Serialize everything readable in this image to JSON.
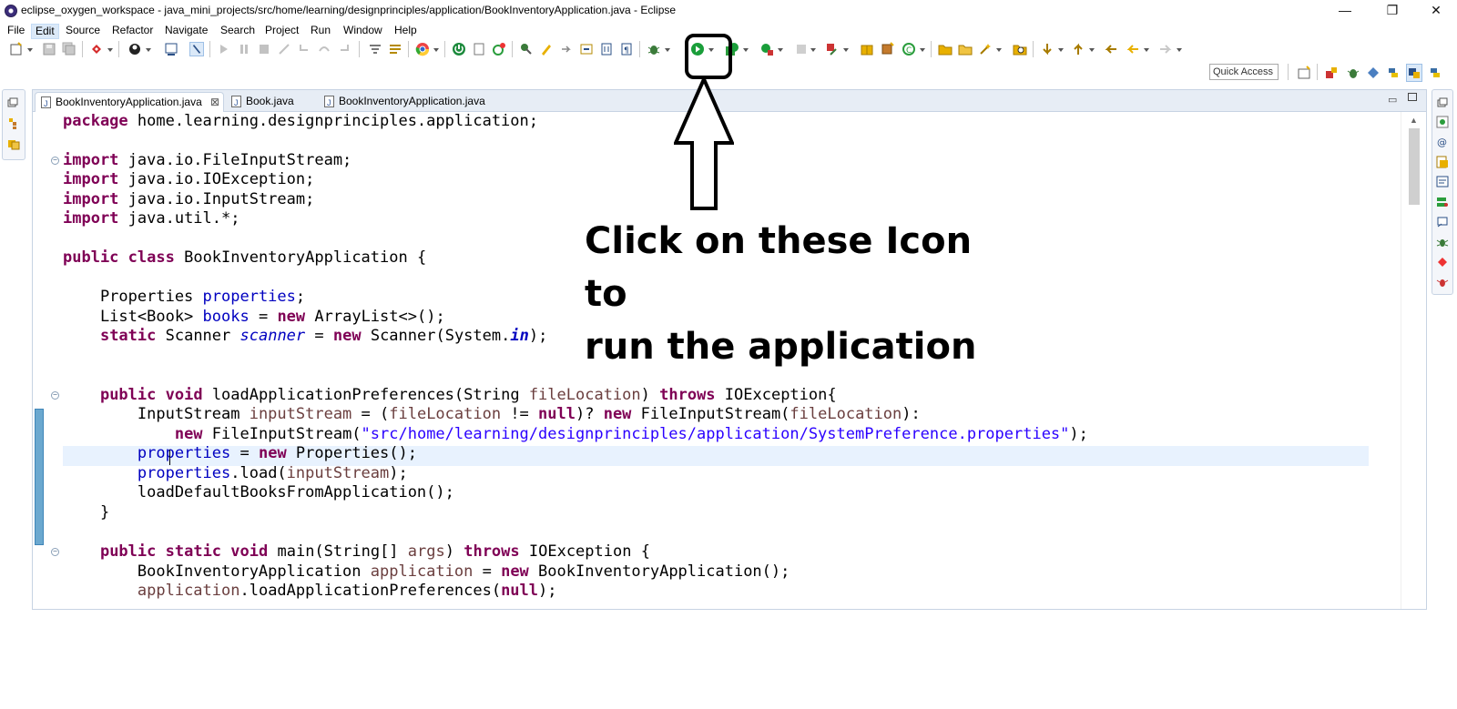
{
  "window": {
    "title": "eclipse_oxygen_workspace - java_mini_projects/src/home/learning/designprinciples/application/BookInventoryApplication.java - Eclipse",
    "minimize": "—",
    "restore": "❐",
    "close": "✕"
  },
  "menu": {
    "items": [
      "File",
      "Edit",
      "Source",
      "Refactor",
      "Navigate",
      "Search",
      "Project",
      "Run",
      "Window",
      "Help"
    ],
    "active_index": 1
  },
  "toolbar": {
    "quick_access": "Quick Access",
    "run_icon_color": "#1a9e3a",
    "debug_icon_color": "#3b7b3a"
  },
  "editor": {
    "tabs": [
      "BookInventoryApplication.java",
      "Book.java",
      "BookInventoryApplication.java"
    ],
    "active_tab": 0,
    "tab_close": "⊠",
    "code": {
      "l1": {
        "kw1": "package",
        "rest": " home.learning.designprinciples.application;"
      },
      "l3": {
        "kw": "import",
        "rest": " java.io.FileInputStream;"
      },
      "l4": {
        "kw": "import",
        "rest": " java.io.IOException;"
      },
      "l5": {
        "kw": "import",
        "rest": " java.io.InputStream;"
      },
      "l6": {
        "kw": "import",
        "rest": " java.util.*;"
      },
      "l8": {
        "kw1": "public",
        "kw2": "class",
        "rest": " BookInventoryApplication {"
      },
      "l10": {
        "type": "    Properties ",
        "field": "properties",
        "end": ";"
      },
      "l11": {
        "type": "    List<Book> ",
        "field": "books",
        "mid": " = ",
        "kw": "new",
        "end": " ArrayList<>();"
      },
      "l12": {
        "kw1": "static",
        "type": " Scanner ",
        "field": "scanner",
        "mid": " = ",
        "kw2": "new",
        "call": " Scanner(System.",
        "sfield": "in",
        "end": ");"
      },
      "l15": {
        "kw1": "public",
        "kw2": "void",
        "name": " loadApplicationPreferences(String ",
        "param": "fileLocation",
        "mid": ") ",
        "kw3": "throws",
        "end": " IOException{"
      },
      "l16": {
        "type": "        InputStream ",
        "var": "inputStream",
        "mid1": " = (",
        "param": "fileLocation",
        "mid2": " != ",
        "kw1": "null",
        "mid3": ")? ",
        "kw2": "new",
        "call": " FileInputStream(",
        "param2": "fileLocation",
        "end": "):"
      },
      "l17": {
        "kw": "new",
        "call": " FileInputStream(",
        "str": "\"src/home/learning/designprinciples/application/SystemPreference.properties\"",
        "end": ");"
      },
      "l18": {
        "field": "properties",
        "mid": " = ",
        "kw": "new",
        "end": " Properties();"
      },
      "l19": {
        "field": "properties",
        "mid": ".load(",
        "var": "inputStream",
        "end": ");"
      },
      "l20": {
        "text": "        loadDefaultBooksFromApplication();"
      },
      "l21": {
        "text": "    }"
      },
      "l23": {
        "kw1": "public",
        "kw2": "static",
        "kw3": "void",
        "name": " main(String[] ",
        "param": "args",
        "mid": ") ",
        "kw4": "throws",
        "end": " IOException {"
      },
      "l24": {
        "type": "        BookInventoryApplication ",
        "var": "application",
        "mid": " = ",
        "kw": "new",
        "end": " BookInventoryApplication();"
      },
      "l25": {
        "var": "application",
        "mid": ".loadApplicationPreferences(",
        "kw": "null",
        "end": ");"
      }
    }
  },
  "annotation": {
    "line1": "Click on these Icon to",
    "line2": "run the application"
  }
}
